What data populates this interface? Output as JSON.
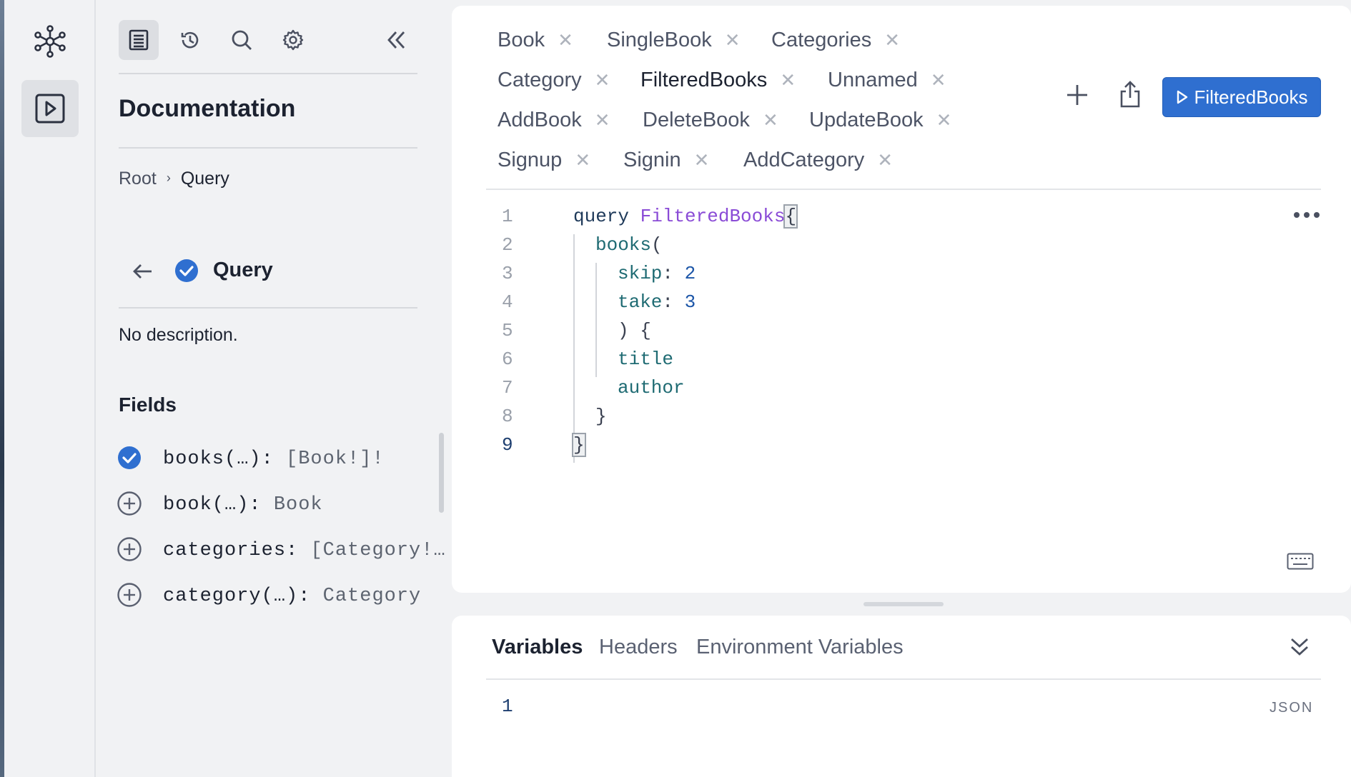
{
  "docs": {
    "title": "Documentation",
    "breadcrumb": {
      "root": "Root",
      "current": "Query"
    },
    "type_heading": "Query",
    "description": "No description.",
    "fields_heading": "Fields",
    "fields": [
      {
        "name": "books(…): ",
        "type": "[Book!]!",
        "selected": true
      },
      {
        "name": "book(…): ",
        "type": "Book",
        "selected": false
      },
      {
        "name": "categories: ",
        "type": "[Category!…",
        "selected": false
      },
      {
        "name": "category(…): ",
        "type": "Category",
        "selected": false
      }
    ]
  },
  "tabs": [
    {
      "label": "Book"
    },
    {
      "label": "SingleBook"
    },
    {
      "label": "Categories"
    },
    {
      "label": "Category"
    },
    {
      "label": "FilteredBooks",
      "active": true
    },
    {
      "label": "Unnamed"
    },
    {
      "label": "AddBook"
    },
    {
      "label": "DeleteBook"
    },
    {
      "label": "UpdateBook"
    },
    {
      "label": "Signup"
    },
    {
      "label": "Signin"
    },
    {
      "label": "AddCategory"
    }
  ],
  "toolbar": {
    "run_label": "FilteredBooks"
  },
  "editor": {
    "lines": [
      {
        "num": "1",
        "text": "query FilteredBooks{"
      },
      {
        "num": "2",
        "text": "books("
      },
      {
        "num": "3",
        "text": "skip: 2"
      },
      {
        "num": "4",
        "text": "take: 3"
      },
      {
        "num": "5",
        "text": ") {"
      },
      {
        "num": "6",
        "text": "title"
      },
      {
        "num": "7",
        "text": "author"
      },
      {
        "num": "8",
        "text": "}"
      },
      {
        "num": "9",
        "text": "}"
      }
    ],
    "current_line": "9"
  },
  "variables_panel": {
    "tabs": [
      "Variables",
      "Headers",
      "Environment Variables"
    ],
    "active_tab": "Variables",
    "line_number": "1",
    "format_label": "JSON"
  },
  "colors": {
    "accent": "#2f6fd0",
    "keyword": "#1f3a5a",
    "operation_name": "#8a4bd6",
    "field": "#1f6b73",
    "number": "#1d56a8"
  },
  "icons": [
    "graphql-logo-icon",
    "play-icon",
    "docs-icon",
    "history-icon",
    "search-icon",
    "gear-icon",
    "collapse-icon",
    "back-arrow-icon",
    "check-circle-icon",
    "plus-circle-icon",
    "plus-icon",
    "share-icon",
    "more-icon",
    "keyboard-icon",
    "chevron-double-down-icon",
    "close-icon"
  ]
}
